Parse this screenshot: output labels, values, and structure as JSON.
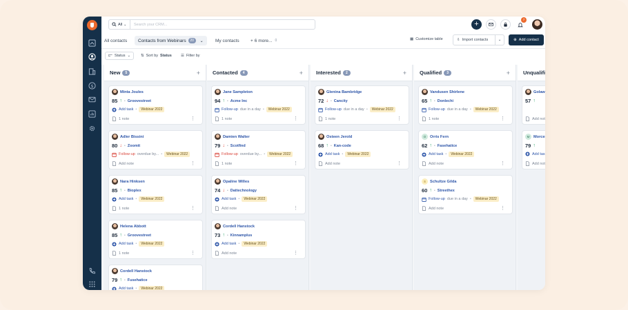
{
  "search": {
    "select": "All",
    "placeholder": "Search your CRM..."
  },
  "tabs": {
    "all": "All contacts",
    "webinars": "Contacts from Webinars",
    "webinars_count": "20",
    "my": "My contacts",
    "more": "6 more...",
    "more_count": "0"
  },
  "toolbar": {
    "customize": "Customize table",
    "import": "Import contacts",
    "add": "Add contact",
    "notif_count": "7"
  },
  "filters": {
    "status": "Status",
    "sort_prefix": "Sort by",
    "sort_field": "Status",
    "filter": "Filter by"
  },
  "colors": {
    "nav": "#153049",
    "accent": "#ec6a2e",
    "link": "#2d55a8",
    "up": "#2fa36a",
    "down": "#e24b3b",
    "tag_bg": "#fbeec8"
  },
  "columns": [
    {
      "title": "New",
      "count": "5",
      "cards": [
        {
          "name": "Minta Joules",
          "score": "85",
          "trend": "up",
          "company": "Groovestreet",
          "task": "Add task",
          "task_type": "add",
          "task_extra": "",
          "tag": "Webinar 2022",
          "note": "1 note",
          "avatar": "photo"
        },
        {
          "name": "Adler Bissini",
          "score": "80",
          "trend": "down",
          "company": "Zoomit",
          "task": "Follow-up",
          "task_type": "overdue",
          "task_extra": "overdue by...",
          "tag": "Webinar 2022",
          "note": "Add note",
          "avatar": "photo"
        },
        {
          "name": "Nara Hinksen",
          "score": "85",
          "trend": "up",
          "company": "Bioplex",
          "task": "Add task",
          "task_type": "add",
          "task_extra": "",
          "tag": "Webinar 2022",
          "note": "1 note",
          "avatar": "photo"
        },
        {
          "name": "Helena Abbott",
          "score": "85",
          "trend": "up",
          "company": "Groovestreet",
          "task": "Add task",
          "task_type": "add",
          "task_extra": "",
          "tag": "Webinar 2022",
          "note": "1 note",
          "avatar": "photo"
        },
        {
          "name": "Cordell Hanstock",
          "score": "79",
          "trend": "up",
          "company": "Fusehatice",
          "task": "Add task",
          "task_type": "add",
          "task_extra": "",
          "tag": "Webinar 2022",
          "note": "",
          "avatar": "photo"
        }
      ]
    },
    {
      "title": "Contacted",
      "count": "4",
      "cards": [
        {
          "name": "Jane Sampleton",
          "score": "94",
          "trend": "up",
          "company": "Acme Inc",
          "task": "Follow-up",
          "task_type": "due",
          "task_extra": "due in a day",
          "tag": "Webinar 2022",
          "note": "1 note",
          "avatar": "photo"
        },
        {
          "name": "Damien Walter",
          "score": "79",
          "trend": "down",
          "company": "Scotfind",
          "task": "Follow-up",
          "task_type": "overdue",
          "task_extra": "overdue by...",
          "tag": "Webinar 2022",
          "note": "1 note",
          "avatar": "photo"
        },
        {
          "name": "Opaline Willes",
          "score": "74",
          "trend": "down",
          "company": "Dattechnology",
          "task": "Add task",
          "task_type": "add",
          "task_extra": "",
          "tag": "Webinar 2022",
          "note": "Add note",
          "avatar": "photo"
        },
        {
          "name": "Cordell Hanstock",
          "score": "73",
          "trend": "up",
          "company": "Kinnamplus",
          "task": "Add task",
          "task_type": "add",
          "task_extra": "",
          "tag": "Webinar 2022",
          "note": "Add note",
          "avatar": "photo"
        }
      ]
    },
    {
      "title": "Interested",
      "count": "2",
      "cards": [
        {
          "name": "Glenina Bambridge",
          "score": "72",
          "trend": "down",
          "company": "Cancity",
          "task": "Follow-up",
          "task_type": "due",
          "task_extra": "due in a day",
          "tag": "Webinar 2022",
          "note": "1 note",
          "avatar": "photo"
        },
        {
          "name": "Osteen Jerold",
          "score": "68",
          "trend": "up",
          "company": "Kan-code",
          "task": "Add task",
          "task_type": "add",
          "task_extra": "",
          "tag": "Webinar 2022",
          "note": "Add note",
          "avatar": "photo"
        }
      ]
    },
    {
      "title": "Qualified",
      "count": "3",
      "cards": [
        {
          "name": "Vandusen Shirlene",
          "score": "65",
          "trend": "up",
          "company": "Donlechi",
          "task": "Follow-up",
          "task_type": "due",
          "task_extra": "due in a day",
          "tag": "Webinar 2022",
          "note": "1 note",
          "avatar": "photo"
        },
        {
          "name": "Orris Fern",
          "score": "62",
          "trend": "up",
          "company": "Fasehatice",
          "task": "Add task",
          "task_type": "add",
          "task_extra": "",
          "tag": "Webinar 2022",
          "note": "Add note",
          "avatar": "ini",
          "initial": "O"
        },
        {
          "name": "Schultze Gilda",
          "score": "60",
          "trend": "up",
          "company": "Streethex",
          "task": "Follow-up",
          "task_type": "due",
          "task_extra": "due in a day",
          "tag": "Webinar 2022",
          "note": "Add note",
          "avatar": "ini2",
          "initial": "S"
        }
      ]
    },
    {
      "title": "Unqualified",
      "count": "",
      "cards": [
        {
          "name": "Golawe",
          "score": "57",
          "trend": "up",
          "company": "",
          "task": "",
          "task_type": "none",
          "task_extra": "",
          "tag": "",
          "note": "Add note",
          "avatar": "photo"
        },
        {
          "name": "Morcen",
          "score": "79",
          "trend": "up",
          "company": "",
          "task": "Add task",
          "task_type": "add",
          "task_extra": "",
          "tag": "",
          "note": "Add note",
          "avatar": "ini",
          "initial": "M"
        }
      ]
    }
  ]
}
